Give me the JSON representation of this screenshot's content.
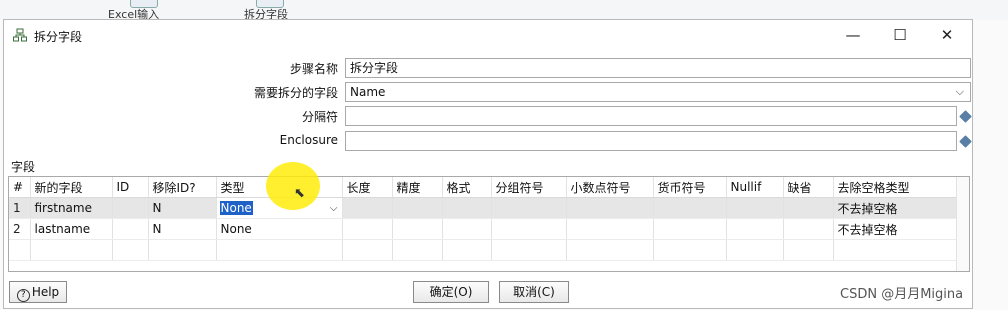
{
  "background_steps": [
    {
      "label": "Excel输入"
    },
    {
      "label": "拆分字段"
    }
  ],
  "window": {
    "title": "拆分字段",
    "controls": {
      "minimize": "—",
      "maximize": "☐",
      "close": "✕"
    }
  },
  "form": {
    "step_name_label": "步骤名称",
    "step_name_value": "拆分字段",
    "field_to_split_label": "需要拆分的字段",
    "field_to_split_value": "Name",
    "delimiter_label": "分隔符",
    "delimiter_value": "",
    "enclosure_label": "Enclosure",
    "enclosure_value": ""
  },
  "fields_section_label": "字段",
  "table": {
    "columns": [
      "#",
      "新的字段",
      "ID",
      "移除ID?",
      "类型",
      "长度",
      "精度",
      "格式",
      "分组符号",
      "小数点符号",
      "货币符号",
      "Nullif",
      "缺省",
      "去除空格类型"
    ],
    "rows": [
      {
        "num": "1",
        "name": "firstname",
        "id": "",
        "remove_id": "N",
        "type": "None",
        "length": "",
        "precision": "",
        "format": "",
        "group": "",
        "decimal": "",
        "currency": "",
        "nullif": "",
        "default": "",
        "trim": "不去掉空格"
      },
      {
        "num": "2",
        "name": "lastname",
        "id": "",
        "remove_id": "N",
        "type": "None",
        "length": "",
        "precision": "",
        "format": "",
        "group": "",
        "decimal": "",
        "currency": "",
        "nullif": "",
        "default": "",
        "trim": "不去掉空格"
      }
    ]
  },
  "buttons": {
    "help": "Help",
    "ok": "确定(O)",
    "cancel": "取消(C)"
  },
  "watermark": "CSDN @月月Migina"
}
